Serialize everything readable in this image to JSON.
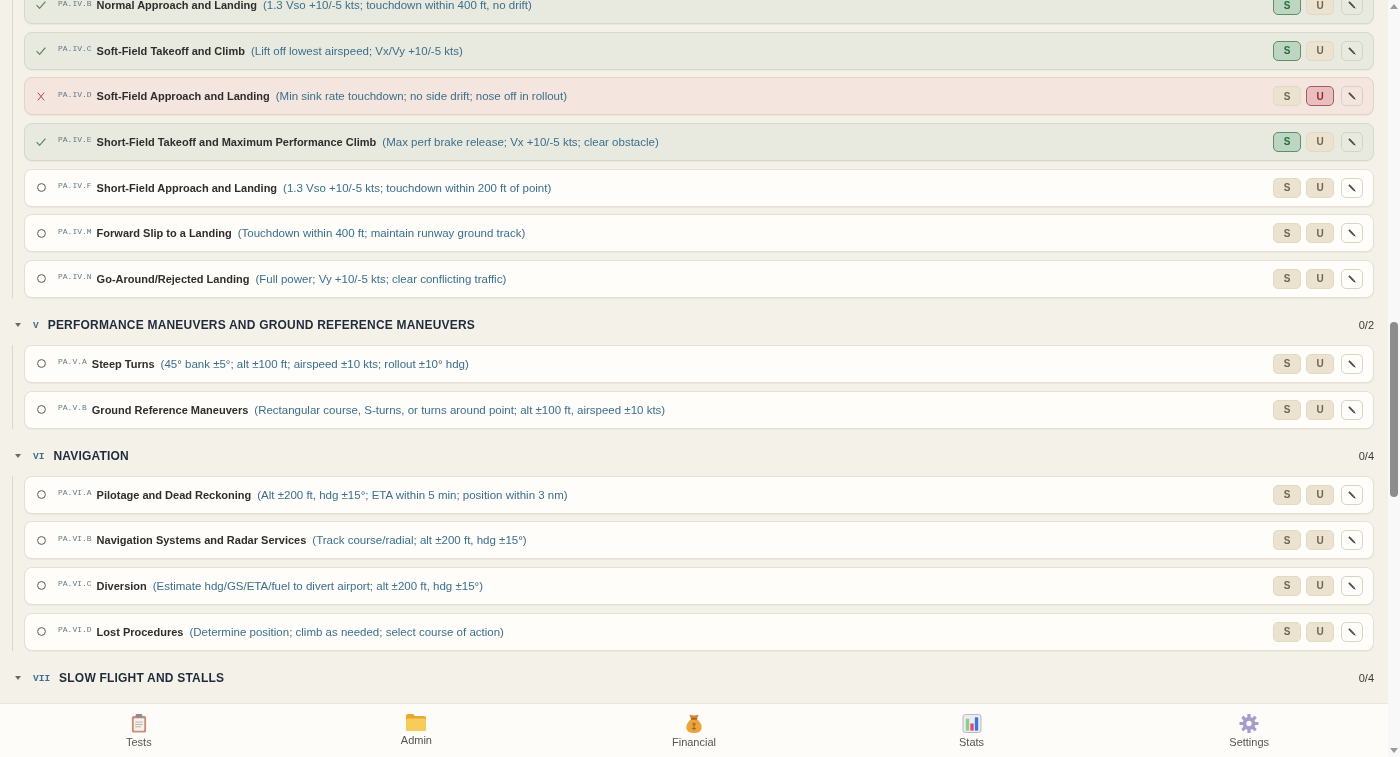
{
  "sections": [
    {
      "items": [
        {
          "code": "PA.IV.B",
          "title": "Normal Approach and Landing",
          "standards": "(1.3 Vso +10/-5 kts; touchdown within 400 ft, no drift)",
          "buttons": [
            {
              "label": "S",
              "selected": true
            },
            {
              "label": "U",
              "selected": false
            }
          ]
        },
        {
          "code": "PA.IV.C",
          "title": "Soft-Field Takeoff and Climb",
          "standards": "(Lift off lowest airspeed; Vx/Vy +10/-5 kts)",
          "buttons": [
            {
              "label": "S",
              "selected": true
            },
            {
              "label": "U",
              "selected": false
            }
          ]
        },
        {
          "code": "PA.IV.D",
          "title": "Soft-Field Approach and Landing",
          "standards": "(Min sink rate touchdown; no side drift; nose off in rollout)",
          "buttons": [
            {
              "label": "S",
              "selected": false
            },
            {
              "label": "U",
              "selected": true
            }
          ]
        },
        {
          "code": "PA.IV.E",
          "title": "Short-Field Takeoff and Maximum Performance Climb",
          "standards": "(Max perf brake release; Vx +10/-5 kts; clear obstacle)",
          "buttons": [
            {
              "label": "S",
              "selected": true
            },
            {
              "label": "U",
              "selected": false
            }
          ]
        },
        {
          "code": "PA.IV.F",
          "title": "Short-Field Approach and Landing",
          "standards": "(1.3 Vso +10/-5 kts; touchdown within 200 ft of point)",
          "buttons": [
            {
              "label": "S",
              "selected": false
            },
            {
              "label": "U",
              "selected": false
            }
          ]
        },
        {
          "code": "PA.IV.M",
          "title": "Forward Slip to a Landing",
          "standards": "(Touchdown within 400 ft; maintain runway ground track)",
          "buttons": [
            {
              "label": "S",
              "selected": false
            },
            {
              "label": "U",
              "selected": false
            }
          ]
        },
        {
          "code": "PA.IV.N",
          "title": "Go-Around/Rejected Landing",
          "standards": "(Full power; Vy +10/-5 kts; clear conflicting traffic)",
          "buttons": [
            {
              "label": "S",
              "selected": false
            },
            {
              "label": "U",
              "selected": false
            }
          ]
        }
      ]
    },
    {
      "expanded": true,
      "numeral": "V",
      "title": "PERFORMANCE MANEUVERS AND GROUND REFERENCE MANEUVERS",
      "count": "0/2",
      "items": [
        {
          "code": "PA.V.A",
          "title": "Steep Turns",
          "standards": "(45° bank ±5°; alt ±100 ft; airspeed ±10 kts; rollout ±10° hdg)",
          "buttons": [
            {
              "label": "S",
              "selected": false
            },
            {
              "label": "U",
              "selected": false
            }
          ]
        },
        {
          "code": "PA.V.B",
          "title": "Ground Reference Maneuvers",
          "standards": "(Rectangular course, S-turns, or turns around point; alt ±100 ft, airspeed ±10 kts)",
          "buttons": [
            {
              "label": "S",
              "selected": false
            },
            {
              "label": "U",
              "selected": false
            }
          ]
        }
      ]
    },
    {
      "expanded": true,
      "numeral": "VI",
      "title": "NAVIGATION",
      "count": "0/4",
      "items": [
        {
          "code": "PA.VI.A",
          "title": "Pilotage and Dead Reckoning",
          "standards": "(Alt ±200 ft, hdg ±15°; ETA within 5 min; position within 3 nm)",
          "buttons": [
            {
              "label": "S",
              "selected": false
            },
            {
              "label": "U",
              "selected": false
            }
          ]
        },
        {
          "code": "PA.VI.B",
          "title": "Navigation Systems and Radar Services",
          "standards": "(Track course/radial; alt ±200 ft, hdg ±15°)",
          "buttons": [
            {
              "label": "S",
              "selected": false
            },
            {
              "label": "U",
              "selected": false
            }
          ]
        },
        {
          "code": "PA.VI.C",
          "title": "Diversion",
          "standards": "(Estimate hdg/GS/ETA/fuel to divert airport; alt ±200 ft, hdg ±15°)",
          "buttons": [
            {
              "label": "S",
              "selected": false
            },
            {
              "label": "U",
              "selected": false
            }
          ]
        },
        {
          "code": "PA.VI.D",
          "title": "Lost Procedures",
          "standards": "(Determine position; climb as needed; select course of action)",
          "buttons": [
            {
              "label": "S",
              "selected": false
            },
            {
              "label": "U",
              "selected": false
            }
          ]
        }
      ]
    },
    {
      "expanded": true,
      "numeral": "VII",
      "title": "SLOW FLIGHT AND STALLS",
      "count": "0/4"
    }
  ],
  "bottom_nav": [
    {
      "label": "Tests",
      "selected": false
    },
    {
      "label": "Admin",
      "selected": false
    },
    {
      "label": "Financial",
      "selected": false
    },
    {
      "label": "Stats",
      "selected": false
    },
    {
      "label": "Settings",
      "selected": false
    }
  ]
}
